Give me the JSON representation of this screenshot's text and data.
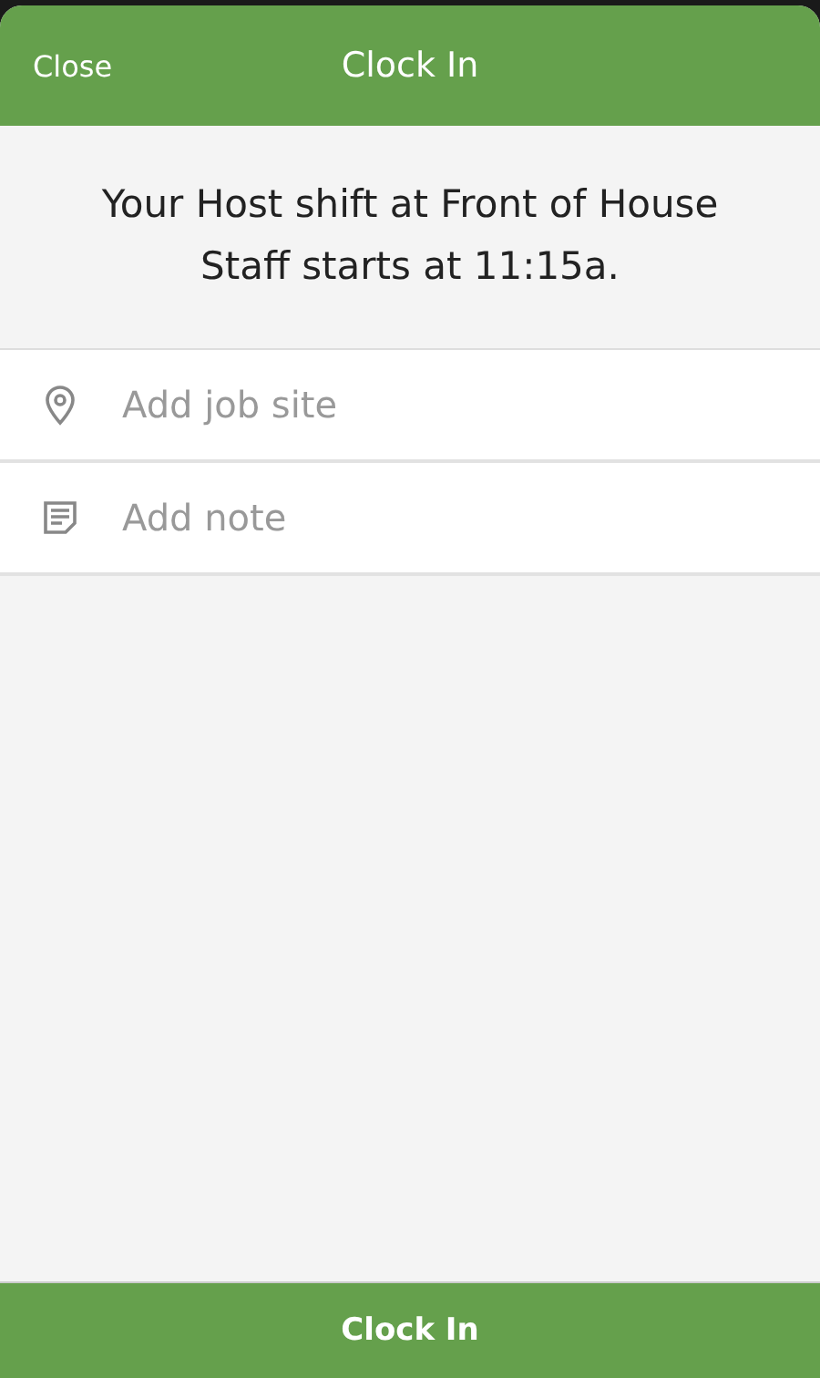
{
  "header": {
    "close": "Close",
    "title": "Clock In"
  },
  "message": "Your Host shift at Front of House Staff starts at 11:15a.",
  "fields": [
    {
      "kind": "location",
      "placeholder": "Add job site"
    },
    {
      "kind": "note",
      "placeholder": "Add note"
    }
  ],
  "footer_button": "Clock In"
}
